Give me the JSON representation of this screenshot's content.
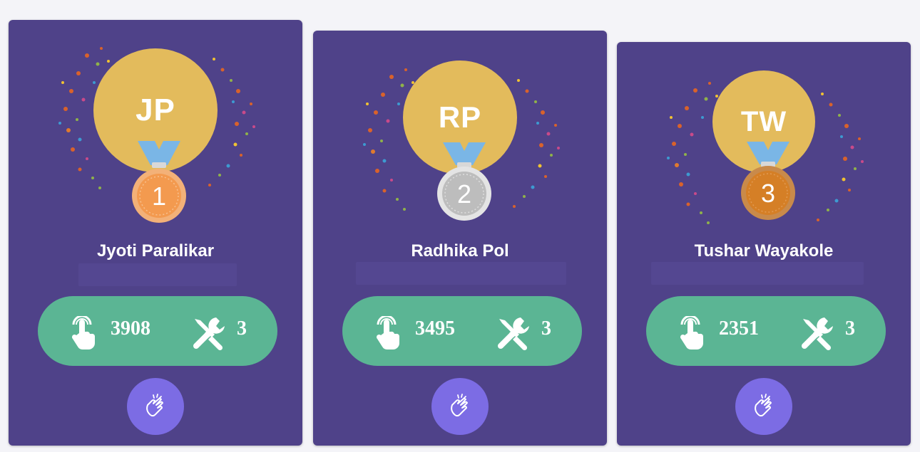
{
  "colors": {
    "card_background": "#4f4289",
    "avatar_background": "#e3bb5c",
    "stats_pill": "#5bb594",
    "clap_button": "#7c6ce4",
    "gold_medal": "#f39a4f",
    "silver_medal": "#cfcfcf",
    "bronze_medal": "#d57f26",
    "ribbon": "#7ab6e6"
  },
  "icons": {
    "taps": "tap-hand-icon",
    "tools": "tools-icon",
    "clap": "clap-hands-icon"
  },
  "leaderboard": [
    {
      "rank": "1",
      "initials": "JP",
      "name": "Jyoti Paralikar",
      "taps": "3908",
      "tools": "3"
    },
    {
      "rank": "2",
      "initials": "RP",
      "name": "Radhika Pol",
      "taps": "3495",
      "tools": "3"
    },
    {
      "rank": "3",
      "initials": "TW",
      "name": "Tushar Wayakole",
      "taps": "2351",
      "tools": "3"
    }
  ]
}
